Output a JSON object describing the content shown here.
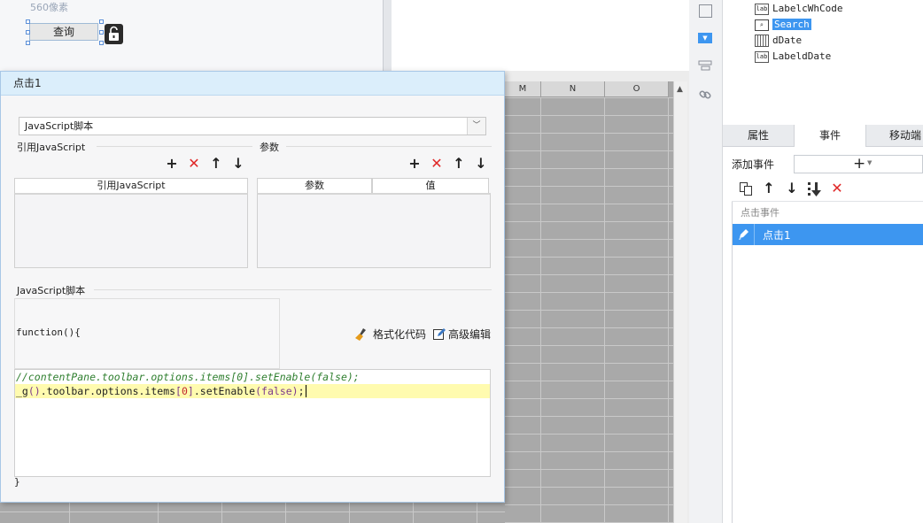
{
  "canvas": {
    "size_label": "560像素",
    "query_button": "查询",
    "grid_columns": [
      "M",
      "N",
      "O"
    ]
  },
  "right_panel": {
    "tree_items": [
      {
        "label": "LabelcWhCode",
        "icon": "label-icon"
      },
      {
        "label": "Search",
        "icon": "search-widget-icon",
        "selected": true
      },
      {
        "label": "dDate",
        "icon": "date-widget-icon"
      },
      {
        "label": "LabeldDate",
        "icon": "label-icon"
      }
    ],
    "tabs": [
      "属性",
      "事件",
      "移动端"
    ],
    "active_tab": "事件",
    "add_event_label": "添加事件",
    "event_caption": "点击事件",
    "event_item": "点击1"
  },
  "dialog": {
    "title": "点击1",
    "script_type": "JavaScript脚本",
    "ref_js_section": "引用JavaScript",
    "params_section": "参数",
    "ref_js_column": "引用JavaScript",
    "param_columns": [
      "参数",
      "值"
    ],
    "script_section": "JavaScript脚本",
    "function_open": "function(){",
    "function_close": "}",
    "format_code_label": "格式化代码",
    "advanced_edit_label": "高级编辑",
    "code_line_1": "//contentPane.toolbar.options.items[0].setEnable(false);"
  },
  "colors": {
    "selection": "#3d96f0",
    "dialog_title_bg": "#dbeefb",
    "delete_red": "#e02828",
    "current_line": "#fffbaf"
  }
}
